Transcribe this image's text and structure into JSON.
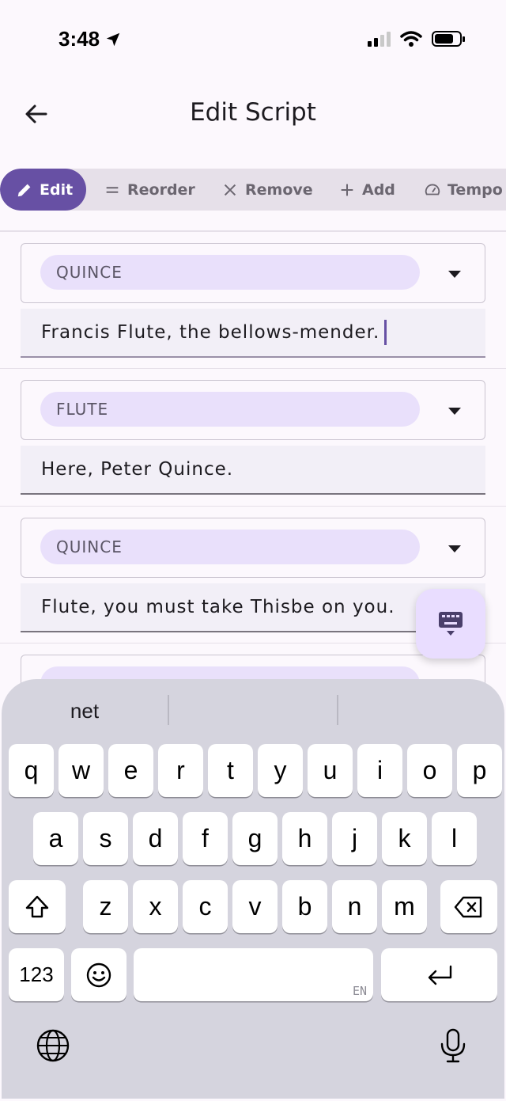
{
  "status_bar": {
    "time": "3:48",
    "icons": [
      "location-arrow-icon",
      "cellular-signal-icon",
      "wifi-icon",
      "battery-icon"
    ]
  },
  "app_bar": {
    "title": "Edit Script",
    "back_icon": "arrow-left-icon"
  },
  "tabs": [
    {
      "label": "Edit",
      "icon": "pencil-icon",
      "active": true
    },
    {
      "label": "Reorder",
      "icon": "drag-handle-icon",
      "active": false
    },
    {
      "label": "Remove",
      "icon": "close-icon",
      "active": false
    },
    {
      "label": "Add",
      "icon": "plus-icon",
      "active": false
    },
    {
      "label": "Tempo",
      "icon": "speedometer-icon",
      "active": false
    }
  ],
  "entries": [
    {
      "role": "QUINCE",
      "line": "Francis Flute, the bellows-mender.",
      "focused": true
    },
    {
      "role": "FLUTE",
      "line": "Here, Peter Quince.",
      "focused": false
    },
    {
      "role": "QUINCE",
      "line": "Flute, you must take Thisbe on you.",
      "focused": false
    }
  ],
  "fab": {
    "icon": "keyboard-hide-icon"
  },
  "keyboard": {
    "suggestions": [
      "net",
      "",
      ""
    ],
    "row1": [
      "q",
      "w",
      "e",
      "r",
      "t",
      "y",
      "u",
      "i",
      "o",
      "p"
    ],
    "row2": [
      "a",
      "s",
      "d",
      "f",
      "g",
      "h",
      "j",
      "k",
      "l"
    ],
    "row3": [
      "z",
      "x",
      "c",
      "v",
      "b",
      "n",
      "m"
    ],
    "numbers_label": "123",
    "space_lang": "EN",
    "icons": [
      "shift-icon",
      "backspace-icon",
      "emoji-icon",
      "return-icon",
      "globe-icon",
      "microphone-icon"
    ]
  },
  "colors": {
    "primary": "#6750a4",
    "chip": "#e9e0fb",
    "field": "#f2eff7",
    "keyboard": "#d5d4de"
  }
}
